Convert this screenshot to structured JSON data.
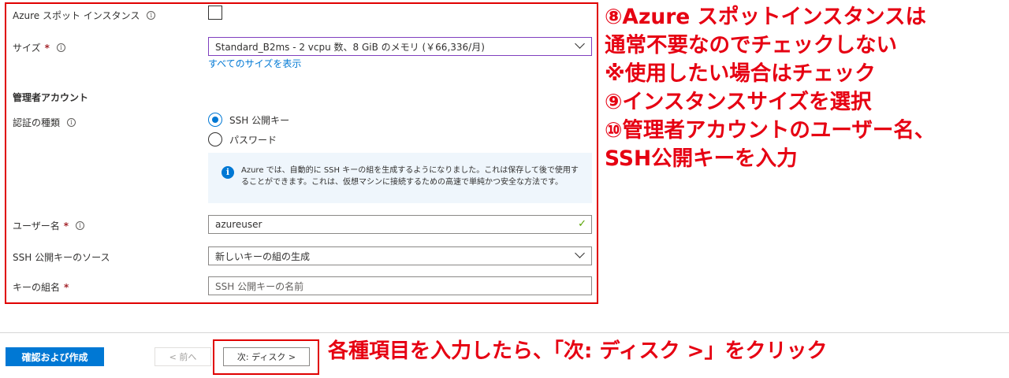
{
  "form": {
    "spot": {
      "label": "Azure スポット インスタンス"
    },
    "size": {
      "label": "サイズ",
      "required": "*",
      "value": "Standard_B2ms - 2 vcpu 数、8 GiB のメモリ (￥66,336/月)",
      "link": "すべてのサイズを表示"
    },
    "admin_heading": "管理者アカウント",
    "auth": {
      "label": "認証の種類",
      "options": [
        "SSH 公開キー",
        "パスワード"
      ],
      "selected": "SSH 公開キー"
    },
    "info_text": "Azure では、自動的に SSH キーの組を生成するようになりました。これは保存して後で使用することができます。これは、仮想マシンに接続するための高速で単純かつ安全な方法です。",
    "username": {
      "label": "ユーザー名",
      "required": "*",
      "value": "azureuser"
    },
    "ssh_source": {
      "label": "SSH 公開キーのソース",
      "value": "新しいキーの組の生成"
    },
    "key_name": {
      "label": "キーの組名",
      "required": "*",
      "placeholder": "SSH 公開キーの名前"
    }
  },
  "buttons": {
    "review": "確認および作成",
    "prev": "< 前へ",
    "next": "次: ディスク >"
  },
  "annotations": {
    "lines": [
      "⑧Azure スポットインスタンスは",
      "通常不要なのでチェックしない",
      "※使用したい場合はチェック",
      "⑨インスタンスサイズを選択",
      "⑩管理者アカウントのユーザー名、",
      "SSH公開キーを入力"
    ],
    "bottom": "各種項目を入力したら、「次: ディスク >」をクリック"
  },
  "icons": {
    "info": "info-icon",
    "check": "checkmark-icon",
    "chevron": "chevron-down-icon"
  },
  "colors": {
    "accent": "#0078d4",
    "annotation_red": "#e60012",
    "valid_green": "#57a300"
  }
}
